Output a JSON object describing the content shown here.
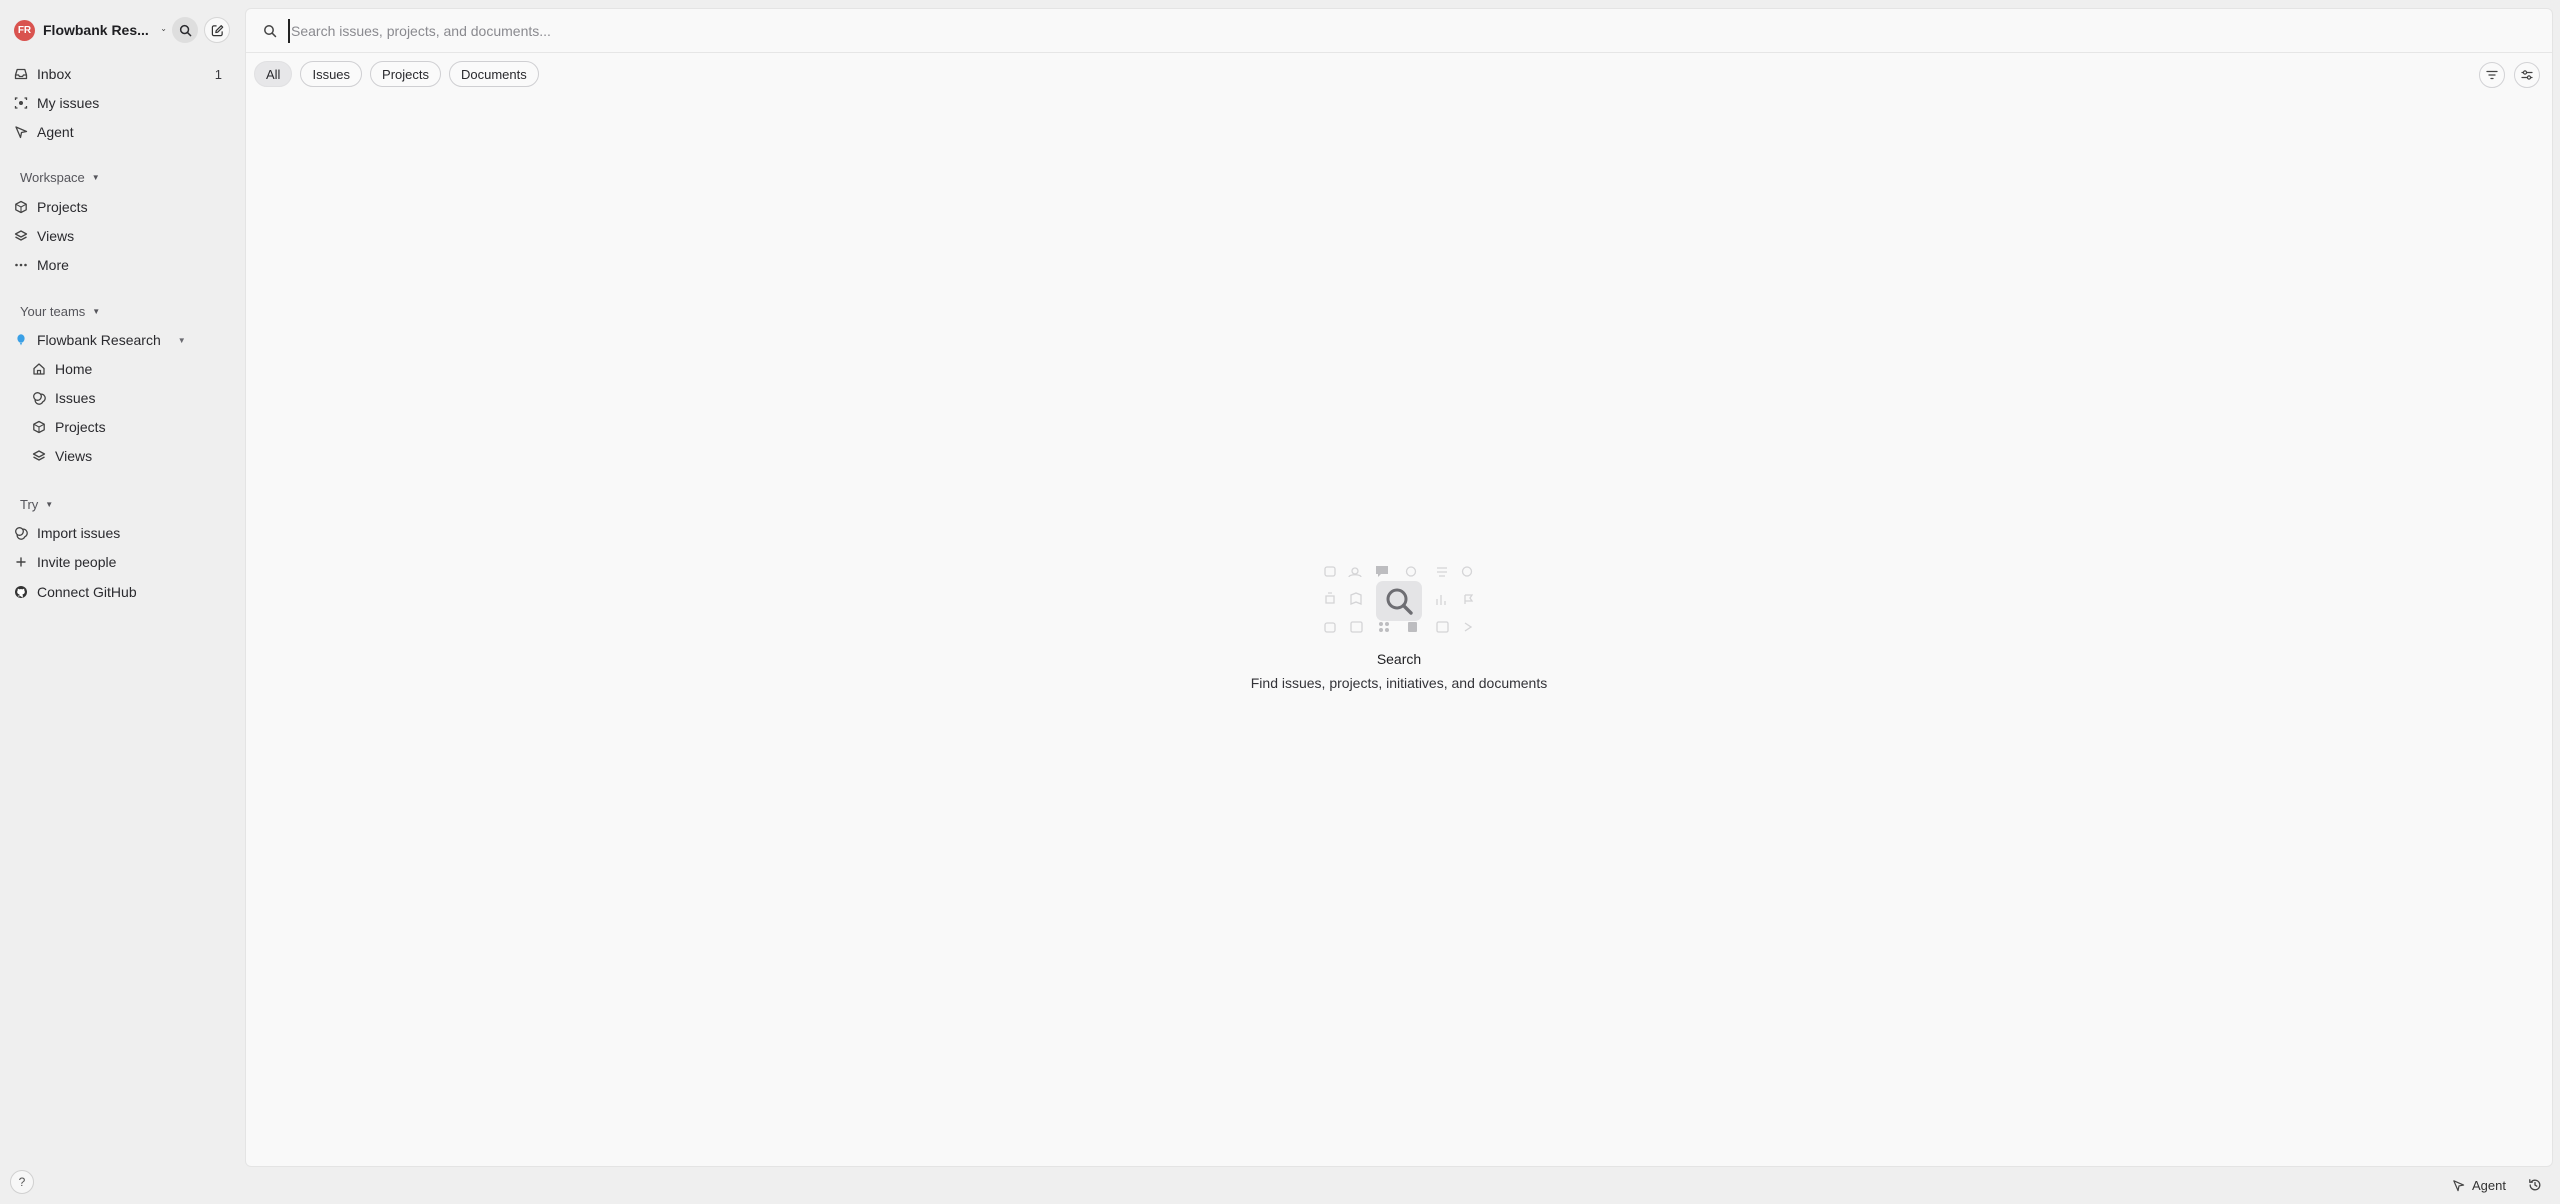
{
  "workspace": {
    "initials": "FR",
    "name": "Flowbank Res..."
  },
  "sidebar": {
    "inbox": {
      "label": "Inbox",
      "count": "1"
    },
    "my_issues": "My issues",
    "agent": "Agent",
    "workspace_section": {
      "label": "Workspace",
      "items": [
        "Projects",
        "Views",
        "More"
      ]
    },
    "teams_section": {
      "label": "Your teams",
      "team_name": "Flowbank Research",
      "team_items": [
        "Home",
        "Issues",
        "Projects",
        "Views"
      ]
    },
    "try_section": {
      "label": "Try",
      "items": [
        "Import issues",
        "Invite people",
        "Connect GitHub"
      ]
    },
    "help": "?"
  },
  "search": {
    "placeholder": "Search issues, projects, and documents...",
    "value": ""
  },
  "filters": {
    "tabs": [
      "All",
      "Issues",
      "Projects",
      "Documents"
    ],
    "active": "All"
  },
  "empty_state": {
    "title": "Search",
    "subtitle": "Find issues, projects, initiatives, and documents"
  },
  "footer": {
    "agent_label": "Agent"
  },
  "colors": {
    "accent_avatar": "#d9534f",
    "team_dot": "#3aa0e6",
    "background": "#efefef",
    "panel": "#f9f9f9"
  }
}
